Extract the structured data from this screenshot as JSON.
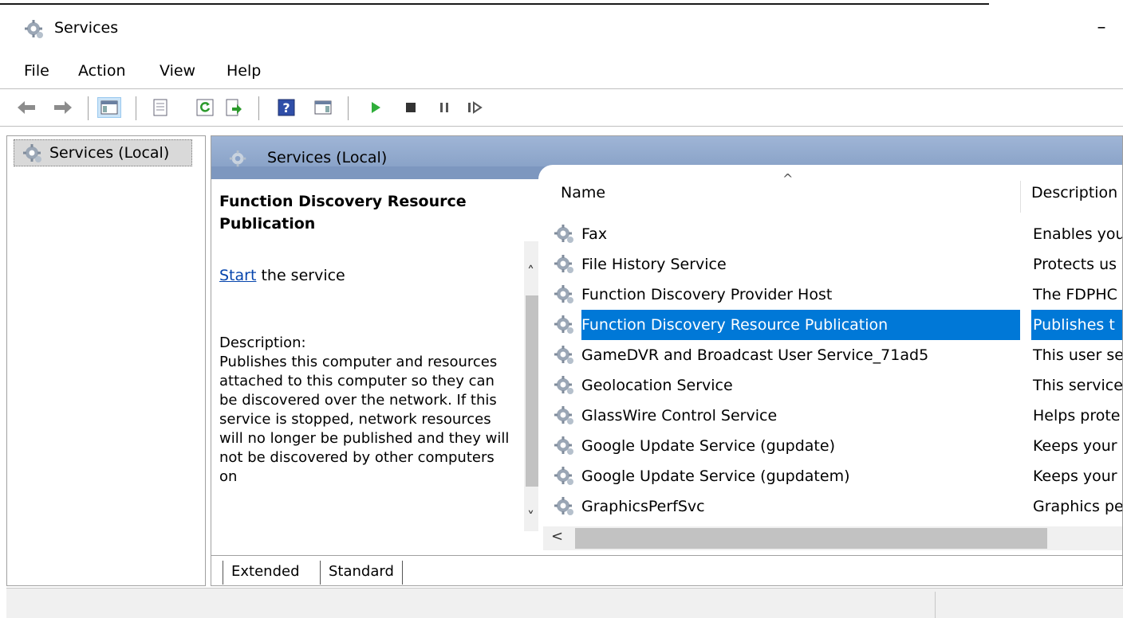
{
  "window": {
    "title": "Services",
    "minimize_glyph": "–"
  },
  "menu": [
    "File",
    "Action",
    "View",
    "Help"
  ],
  "toolbar": {
    "icons": [
      "back-arrow-icon",
      "forward-arrow-icon",
      "show-hide-console-tree-icon",
      "properties-icon",
      "refresh-icon",
      "export-list-icon",
      "help-icon",
      "show-hide-action-pane-icon",
      "start-service-icon",
      "stop-service-icon",
      "pause-service-icon",
      "resume-service-icon"
    ]
  },
  "tree": {
    "root_label": "Services (Local)"
  },
  "panel": {
    "header_title": "Services (Local)",
    "selected_service_title": "Function Discovery Resource Publication",
    "start_link": "Start",
    "start_suffix": " the service",
    "description_label": "Description:",
    "description_text": "Publishes this computer and resources attached to this computer so they can be discovered over the network.  If this service is stopped, network resources will no longer be published and they will not be discovered by other computers on"
  },
  "columns": {
    "name": "Name",
    "description": "Description",
    "sort_indicator": "^"
  },
  "services": [
    {
      "name": "Fax",
      "description": "Enables you"
    },
    {
      "name": "File History Service",
      "description": "Protects us"
    },
    {
      "name": "Function Discovery Provider Host",
      "description": "The FDPHC"
    },
    {
      "name": "Function Discovery Resource Publication",
      "description": "Publishes t",
      "selected": true
    },
    {
      "name": "GameDVR and Broadcast User Service_71ad5",
      "description": "This user se"
    },
    {
      "name": "Geolocation Service",
      "description": "This service"
    },
    {
      "name": "GlassWire Control Service",
      "description": "Helps prote"
    },
    {
      "name": "Google Update Service (gupdate)",
      "description": "Keeps your"
    },
    {
      "name": "Google Update Service (gupdatem)",
      "description": "Keeps your"
    },
    {
      "name": "GraphicsPerfSvc",
      "description": "Graphics pe"
    }
  ],
  "tabs": {
    "extended": "Extended",
    "standard": "Standard"
  },
  "colors": {
    "selection": "#0078d7",
    "header_band": "#7d97bf",
    "link": "#0645ad"
  }
}
